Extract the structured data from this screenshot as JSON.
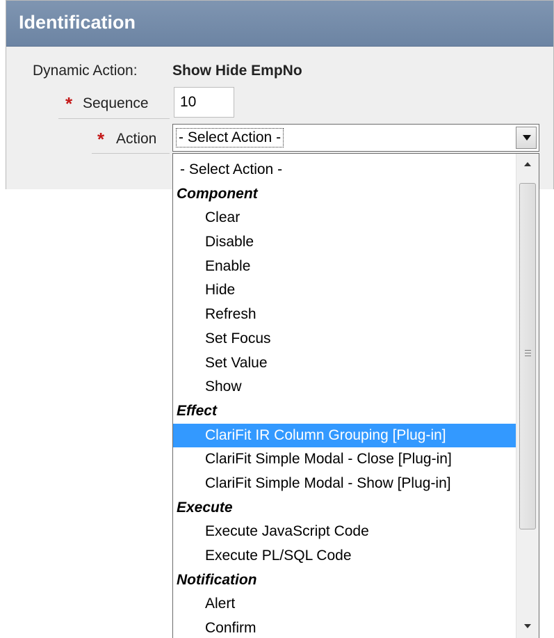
{
  "region": {
    "title": "Identification"
  },
  "form": {
    "dynamic_action_label": "Dynamic Action:",
    "dynamic_action_value": "Show Hide EmpNo",
    "sequence_label": "Sequence",
    "sequence_value": "10",
    "action_label": "Action",
    "action_selected": "- Select Action -",
    "required_marker": "*"
  },
  "dropdown": {
    "items": [
      {
        "type": "option",
        "label": "- Select Action -",
        "first": true
      },
      {
        "type": "group",
        "label": "Component"
      },
      {
        "type": "option",
        "label": "Clear"
      },
      {
        "type": "option",
        "label": "Disable"
      },
      {
        "type": "option",
        "label": "Enable"
      },
      {
        "type": "option",
        "label": "Hide"
      },
      {
        "type": "option",
        "label": "Refresh"
      },
      {
        "type": "option",
        "label": "Set Focus"
      },
      {
        "type": "option",
        "label": "Set Value"
      },
      {
        "type": "option",
        "label": "Show"
      },
      {
        "type": "group",
        "label": "Effect"
      },
      {
        "type": "option",
        "label": "ClariFit IR Column Grouping [Plug-in]",
        "highlighted": true
      },
      {
        "type": "option",
        "label": "ClariFit Simple Modal - Close [Plug-in]"
      },
      {
        "type": "option",
        "label": "ClariFit Simple Modal - Show [Plug-in]"
      },
      {
        "type": "group",
        "label": "Execute"
      },
      {
        "type": "option",
        "label": "Execute JavaScript Code"
      },
      {
        "type": "option",
        "label": "Execute PL/SQL Code"
      },
      {
        "type": "group",
        "label": "Notification"
      },
      {
        "type": "option",
        "label": "Alert"
      },
      {
        "type": "option",
        "label": "Confirm"
      }
    ]
  },
  "colors": {
    "header": "#6c84a3",
    "required": "#c41a1a",
    "highlight": "#3399ff"
  }
}
